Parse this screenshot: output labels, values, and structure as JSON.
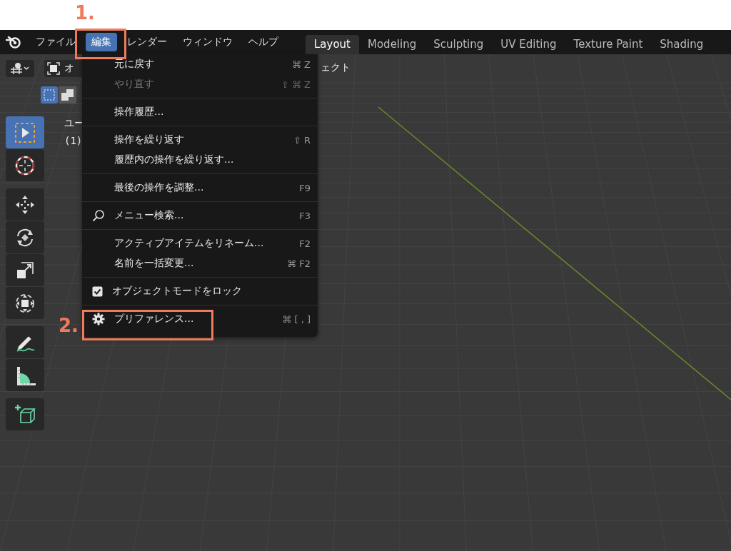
{
  "annotations": [
    {
      "label": "1."
    },
    {
      "label": "2."
    }
  ],
  "menubar": [
    {
      "label": "ファイル",
      "selected": false
    },
    {
      "label": "編集",
      "selected": true
    },
    {
      "label": "レンダー",
      "selected": false
    },
    {
      "label": "ウィンドウ",
      "selected": false
    },
    {
      "label": "ヘルプ",
      "selected": false
    }
  ],
  "workspace_tabs": [
    {
      "label": "Layout",
      "selected": true
    },
    {
      "label": "Modeling",
      "selected": false
    },
    {
      "label": "Sculpting",
      "selected": false
    },
    {
      "label": "UV Editing",
      "selected": false
    },
    {
      "label": "Texture Paint",
      "selected": false
    },
    {
      "label": "Shading",
      "selected": false
    }
  ],
  "header": {
    "mode_label": "オ",
    "trailing_text": "ェクト"
  },
  "viewport_text": [
    "ユー",
    "(1)"
  ],
  "toolbar": {
    "groups": [
      {
        "tools": [
          {
            "kind": "select",
            "selected": true
          },
          {
            "kind": "cursor",
            "selected": false
          }
        ]
      },
      {
        "tools": [
          {
            "kind": "move",
            "selected": false
          },
          {
            "kind": "rotate",
            "selected": false
          },
          {
            "kind": "scale",
            "selected": false
          },
          {
            "kind": "transform",
            "selected": false
          }
        ]
      },
      {
        "tools": [
          {
            "kind": "annotate",
            "selected": false
          },
          {
            "kind": "measure",
            "selected": false
          }
        ]
      },
      {
        "tools": [
          {
            "kind": "add_cube",
            "selected": false
          }
        ]
      }
    ]
  },
  "menu": {
    "groups": [
      {
        "items": [
          {
            "kind": "plain",
            "label": "元に戻す",
            "shortcut": "⌘ Z",
            "disabled": false
          },
          {
            "kind": "plain",
            "label": "やり直す",
            "shortcut": "⇧ ⌘ Z",
            "disabled": true
          }
        ]
      },
      {
        "items": [
          {
            "kind": "plain",
            "label": "操作履歴...",
            "disabled": false
          }
        ]
      },
      {
        "items": [
          {
            "kind": "plain",
            "label": "操作を繰り返す",
            "shortcut": "⇧ R",
            "disabled": false
          },
          {
            "kind": "plain",
            "label": "履歴内の操作を繰り返す...",
            "disabled": false
          }
        ]
      },
      {
        "items": [
          {
            "kind": "plain",
            "label": "最後の操作を調整...",
            "shortcut": "F9",
            "disabled": false
          }
        ]
      },
      {
        "items": [
          {
            "kind": "search",
            "label": "メニュー検索...",
            "shortcut": "F3",
            "disabled": false
          }
        ]
      },
      {
        "items": [
          {
            "kind": "plain",
            "label": "アクティブアイテムをリネーム...",
            "shortcut": "F2",
            "disabled": false
          },
          {
            "kind": "plain",
            "label": "名前を一括変更...",
            "shortcut": "⌘ F2",
            "disabled": false
          }
        ]
      },
      {
        "items": [
          {
            "kind": "checkbox",
            "label": "オブジェクトモードをロック",
            "checked": true,
            "disabled": false
          }
        ]
      },
      {
        "items": [
          {
            "kind": "settings",
            "label": "プリファレンス...",
            "shortcut": "⌘ [ , ]",
            "disabled": false
          }
        ]
      }
    ]
  }
}
